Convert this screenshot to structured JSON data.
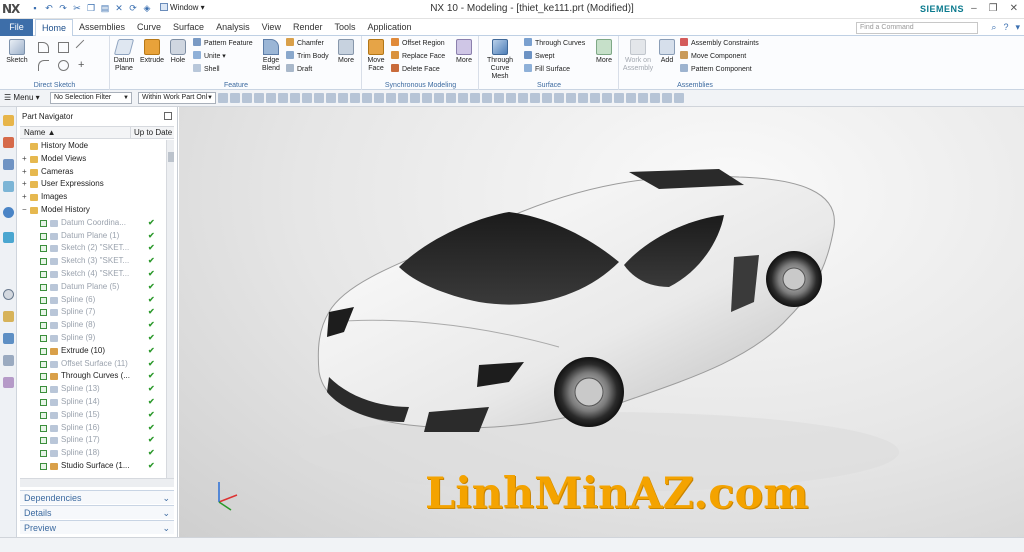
{
  "window": {
    "app_logo": "NX",
    "window_menu": "Window",
    "title": "NX 10 - Modeling - [thiet_ke111.prt (Modified)]",
    "brand": "SIEMENS"
  },
  "menu": {
    "file": "File",
    "tabs": [
      "Home",
      "Assemblies",
      "Curve",
      "Surface",
      "Analysis",
      "View",
      "Render",
      "Tools",
      "Application"
    ],
    "active_tab": "Home",
    "find_placeholder": "Find a Command"
  },
  "ribbon": {
    "direct_sketch": {
      "label": "Direct Sketch",
      "sketch": "Sketch"
    },
    "feature": {
      "label": "Feature",
      "datum_plane": "Datum Plane",
      "extrude": "Extrude",
      "hole": "Hole",
      "pattern_feature": "Pattern Feature",
      "unite": "Unite",
      "shell": "Shell",
      "edge_blend": "Edge Blend",
      "chamfer": "Chamfer",
      "trim_body": "Trim Body",
      "draft": "Draft",
      "more": "More"
    },
    "sync": {
      "label": "Synchronous Modeling",
      "move_face": "Move Face",
      "offset_region": "Offset Region",
      "replace_face": "Replace Face",
      "delete_face": "Delete Face",
      "more": "More"
    },
    "surface": {
      "label": "Surface",
      "through_curve_mesh": "Through Curve Mesh",
      "through_curves": "Through Curves",
      "swept": "Swept",
      "fill_surface": "Fill Surface",
      "more": "More"
    },
    "assemblies": {
      "label": "Assemblies",
      "work_on_assembly": "Work on Assembly",
      "add": "Add",
      "assembly_constraints": "Assembly Constraints",
      "move_component": "Move Component",
      "pattern_component": "Pattern Component"
    }
  },
  "selection_bar": {
    "menu": "Menu",
    "filter": "No Selection Filter",
    "scope": "Within Work Part Onl"
  },
  "navigator": {
    "title": "Part Navigator",
    "col_name": "Name",
    "col_status": "Up to Date",
    "nodes": [
      {
        "label": "History Mode",
        "exp": "",
        "ok": false,
        "dim": false
      },
      {
        "label": "Model Views",
        "exp": "+",
        "ok": false,
        "dim": false
      },
      {
        "label": "Cameras",
        "exp": "+",
        "ok": false,
        "dim": false
      },
      {
        "label": "User Expressions",
        "exp": "+",
        "ok": false,
        "dim": false
      },
      {
        "label": "Images",
        "exp": "+",
        "ok": false,
        "dim": false
      },
      {
        "label": "Model History",
        "exp": "−",
        "ok": false,
        "dim": false
      },
      {
        "label": "Datum Coordina...",
        "exp": "",
        "ok": true,
        "dim": true
      },
      {
        "label": "Datum Plane (1)",
        "exp": "",
        "ok": true,
        "dim": true
      },
      {
        "label": "Sketch (2) \"SKET...",
        "exp": "",
        "ok": true,
        "dim": true
      },
      {
        "label": "Sketch (3) \"SKET...",
        "exp": "",
        "ok": true,
        "dim": true
      },
      {
        "label": "Sketch (4) \"SKET...",
        "exp": "",
        "ok": true,
        "dim": true
      },
      {
        "label": "Datum Plane (5)",
        "exp": "",
        "ok": true,
        "dim": true
      },
      {
        "label": "Spline (6)",
        "exp": "",
        "ok": true,
        "dim": true
      },
      {
        "label": "Spline (7)",
        "exp": "",
        "ok": true,
        "dim": true
      },
      {
        "label": "Spline (8)",
        "exp": "",
        "ok": true,
        "dim": true
      },
      {
        "label": "Spline (9)",
        "exp": "",
        "ok": true,
        "dim": true
      },
      {
        "label": "Extrude (10)",
        "exp": "",
        "ok": true,
        "dim": false
      },
      {
        "label": "Offset Surface (11)",
        "exp": "",
        "ok": true,
        "dim": true
      },
      {
        "label": "Through Curves (...",
        "exp": "",
        "ok": true,
        "dim": false
      },
      {
        "label": "Spline (13)",
        "exp": "",
        "ok": true,
        "dim": true
      },
      {
        "label": "Spline (14)",
        "exp": "",
        "ok": true,
        "dim": true
      },
      {
        "label": "Spline (15)",
        "exp": "",
        "ok": true,
        "dim": true
      },
      {
        "label": "Spline (16)",
        "exp": "",
        "ok": true,
        "dim": true
      },
      {
        "label": "Spline (17)",
        "exp": "",
        "ok": true,
        "dim": true
      },
      {
        "label": "Spline (18)",
        "exp": "",
        "ok": true,
        "dim": true
      },
      {
        "label": "Studio Surface (1...",
        "exp": "",
        "ok": true,
        "dim": false
      }
    ],
    "panels": [
      "Dependencies",
      "Details",
      "Preview"
    ]
  },
  "viewport": {
    "watermark": "LinhMinAZ.com"
  }
}
